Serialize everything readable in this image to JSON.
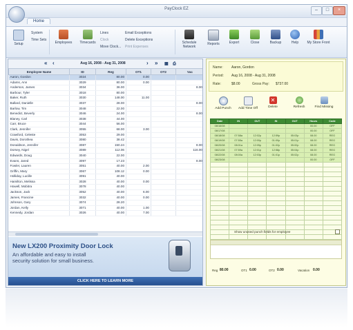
{
  "window": {
    "title": "PayClock EZ"
  },
  "ribbon": {
    "tab": "Home",
    "buttons": {
      "setup": "Setup",
      "employees": "Employees",
      "timecards": "Timecards",
      "schedule_network": "Schedule Network",
      "reports": "Reports",
      "export": "Export",
      "close": "Close",
      "backup": "Backup",
      "help": "Help",
      "my_store": "My Store Front"
    },
    "small": {
      "system": "System",
      "time_sets": "Time Sets",
      "lines": "Lines",
      "clock": "Clock",
      "move_clock": "Move Clock...",
      "email_exceptions": "Email Exceptions",
      "delete_exceptions": "Delete Exceptions",
      "print_expenses": "Print Expenses"
    }
  },
  "timecard": {
    "date_range": "Aug 16, 2008 - Aug 31, 2008",
    "columns": [
      "Employee Name",
      "ID",
      "Reg",
      "OT1",
      "OT2",
      "Vac"
    ],
    "rows": [
      [
        "Aaron, Gordon",
        "3024",
        "80.00",
        "0.00",
        "",
        ""
      ],
      [
        "Adams, Ann",
        "3029",
        "80.00",
        "0.00",
        "",
        ""
      ],
      [
        "Anderson, James",
        "3034",
        "36.00",
        "",
        "",
        "8.00"
      ],
      [
        "Barbour, Tyler",
        "3018",
        "80.00",
        "",
        "",
        ""
      ],
      [
        "Baker, Ruth",
        "3030",
        "148.00",
        "11.00",
        "",
        ""
      ],
      [
        "Ballard, Danielle",
        "3037",
        "28.00",
        "",
        "",
        "8.00"
      ],
      [
        "Barlow, Tim",
        "3048",
        "22.00",
        "",
        "",
        ""
      ],
      [
        "Benedict, Beverly",
        "3046",
        "24.00",
        "",
        "",
        "8.00"
      ],
      [
        "Blaney, Carl",
        "3038",
        "44.00",
        "",
        "",
        ""
      ],
      [
        "Carr, Bruce",
        "3044",
        "56.00",
        "",
        "",
        ""
      ],
      [
        "Clark, Jennifer",
        "3055",
        "68.00",
        "3.00",
        "",
        ""
      ],
      [
        "Crawford, Celeste",
        "3053",
        "29.00",
        "",
        "",
        ""
      ],
      [
        "Davis, Dorothea",
        "3080",
        "38.42",
        "",
        "",
        ""
      ],
      [
        "Donaldson, Jennifer",
        "3087",
        "150.24",
        "",
        "",
        "8.00"
      ],
      [
        "Dorsey, Nigel",
        "3089",
        "112.06",
        "",
        "",
        "116.00"
      ],
      [
        "Edwards, Doug",
        "3040",
        "22.00",
        "",
        "",
        ""
      ],
      [
        "Evans, Jared",
        "3097",
        "17.23",
        "",
        "",
        "8.00"
      ],
      [
        "Fowler, Lauren",
        "3051",
        "40.00",
        "2.00",
        "",
        ""
      ],
      [
        "Griffin, Mary",
        "3067",
        "108.12",
        "0.00",
        "",
        ""
      ],
      [
        "Holliday, Lucille",
        "3091",
        "40.00",
        "",
        "",
        ""
      ],
      [
        "Hamilton, Melissa",
        "3028",
        "40.00",
        "0.00",
        "",
        ""
      ],
      [
        "Howell, Mobitra",
        "3078",
        "40.00",
        "",
        "",
        ""
      ],
      [
        "Jackson, Jack",
        "3052",
        "40.00",
        "6.00",
        "",
        ""
      ],
      [
        "James, Francine",
        "3032",
        "40.00",
        "0.00",
        "",
        ""
      ],
      [
        "Johnson, Gary",
        "3074",
        "28.20",
        "",
        "",
        ""
      ],
      [
        "Jordan, Kelly",
        "3071",
        "40.00",
        "1.00",
        "",
        ""
      ],
      [
        "Kennedy, Jordan",
        "3026",
        "40.00",
        "7.00",
        "",
        ""
      ]
    ]
  },
  "ad": {
    "headline": "New LX200 Proximity Door Lock",
    "line1": "An affordable and easy to install",
    "line2": "security solution for small business.",
    "cta": "CLICK HERE TO LEARN MORE"
  },
  "employee": {
    "name_label": "Name:",
    "name": "Aaron, Gordon",
    "period_label": "Period:",
    "period": "Aug 16, 2008 - Aug 31, 2008",
    "rate_label": "Rate:",
    "rate": "$8.00",
    "gross_label": "Gross Pay:",
    "gross": "$737.00"
  },
  "actions": {
    "add_punch": "Add Punch",
    "add_time_off": "Add Time Off",
    "delete": "Delete",
    "refresh": "Refresh",
    "find_missing": "Find Missing"
  },
  "punch_grid": {
    "columns": [
      "Date",
      "IN",
      "OUT",
      "IN",
      "OUT",
      "Hours",
      "Code"
    ],
    "rows": [
      [
        "08/16/08",
        "",
        "",
        "",
        "",
        "00.00",
        "OFF"
      ],
      [
        "08/17/08",
        "",
        "",
        "",
        "",
        "00.00",
        "OFF"
      ],
      [
        "08/18/08",
        "07:58a",
        "12:02p",
        "12:59p",
        "05:03p",
        "08.00",
        "REG"
      ],
      [
        "08/19/08",
        "07:55a",
        "12:00p",
        "01:00p",
        "05:01p",
        "08.00",
        "REG"
      ],
      [
        "08/20/08",
        "08:01a",
        "12:05p",
        "01:02p",
        "05:00p",
        "08.00",
        "REG"
      ],
      [
        "08/21/08",
        "07:59a",
        "12:01p",
        "12:58p",
        "05:04p",
        "08.00",
        "REG"
      ],
      [
        "08/22/08",
        "08:00a",
        "12:03p",
        "01:01p",
        "05:02p",
        "08.00",
        "REG"
      ],
      [
        "08/23/08",
        "",
        "",
        "",
        "",
        "00.00",
        "OFF"
      ],
      [
        "",
        "",
        "",
        "",
        "",
        "",
        ""
      ],
      [
        "",
        "",
        "",
        "",
        "",
        "",
        ""
      ],
      [
        "",
        "",
        "",
        "",
        "",
        "",
        ""
      ],
      [
        "",
        "",
        "",
        "",
        "",
        "",
        ""
      ],
      [
        "",
        "",
        "",
        "",
        "",
        "",
        ""
      ],
      [
        "",
        "",
        "",
        "",
        "",
        "",
        ""
      ],
      [
        "",
        "",
        "",
        "",
        "",
        "",
        ""
      ],
      [
        "",
        "",
        "",
        "",
        "",
        "",
        ""
      ],
      [
        "",
        "",
        "",
        "",
        "",
        "",
        ""
      ],
      [
        "",
        "",
        "",
        "",
        "",
        "",
        ""
      ],
      [
        "",
        "",
        "",
        "",
        "",
        "",
        ""
      ],
      [
        "",
        "",
        "",
        "",
        "",
        "",
        ""
      ],
      [
        "",
        "",
        "",
        "",
        "",
        "",
        ""
      ],
      [
        "",
        "",
        "",
        "",
        "",
        "",
        ""
      ],
      [
        "",
        "",
        "",
        "",
        "",
        "",
        ""
      ],
      [
        "",
        "",
        "",
        "",
        "",
        "",
        ""
      ]
    ]
  },
  "show_all_label": "Show unused punch fields for employee",
  "totals": {
    "reg_label": "Reg",
    "reg": "80.00",
    "ot1_label": "OT1",
    "ot1": "0.00",
    "ot2_label": "OT2",
    "ot2": "0.00",
    "vac_label": "Vacation",
    "vac": "0.00"
  },
  "colors": {
    "accent": "#3d8a33",
    "panel": "#fdfde4",
    "ad_blue": "#2c4f86"
  }
}
